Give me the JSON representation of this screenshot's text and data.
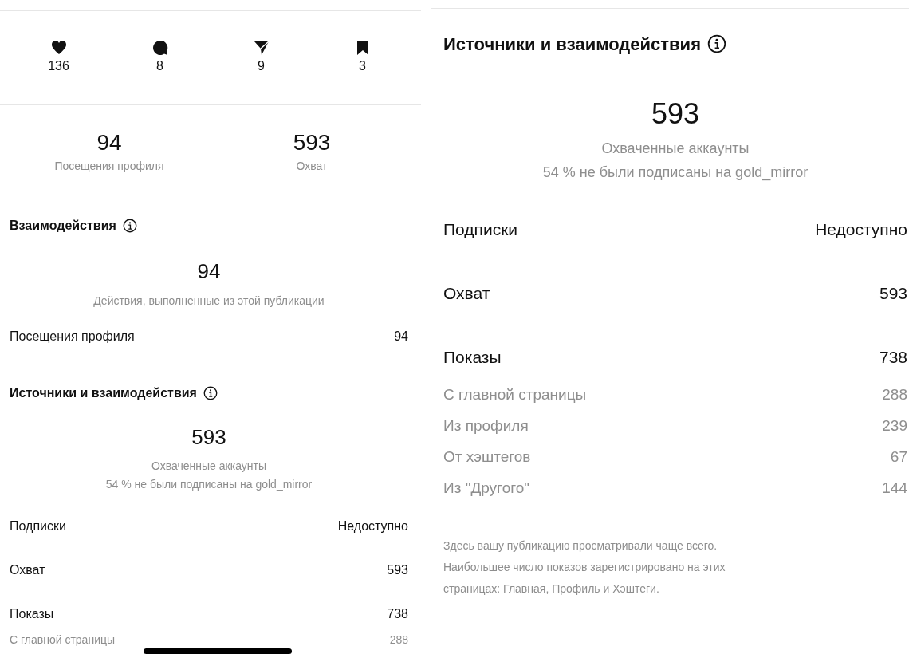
{
  "left": {
    "reactions": [
      {
        "kind": "like",
        "count": "136"
      },
      {
        "kind": "comment",
        "count": "8"
      },
      {
        "kind": "share",
        "count": "9"
      },
      {
        "kind": "save",
        "count": "3"
      }
    ],
    "summary": [
      {
        "value": "94",
        "label": "Посещения профиля"
      },
      {
        "value": "593",
        "label": "Охват"
      }
    ],
    "interactions": {
      "title": "Взаимодействия",
      "total": "94",
      "caption": "Действия, выполненные из этой публикации",
      "rows": [
        {
          "label": "Посещения профиля",
          "value": "94"
        }
      ]
    },
    "sources": {
      "title": "Источники и взаимодействия",
      "total": "593",
      "caption": "Охваченные аккаунты",
      "note": "54 % не были подписаны на gold_mirror",
      "rows": [
        {
          "kind": "main",
          "label": "Подписки",
          "value": "Недоступно"
        },
        {
          "kind": "main",
          "label": "Охват",
          "value": "593"
        },
        {
          "kind": "main",
          "label": "Показы",
          "value": "738"
        },
        {
          "kind": "sub",
          "label": "С главной страницы",
          "value": "288"
        }
      ]
    }
  },
  "right": {
    "sources": {
      "title": "Источники и взаимодействия",
      "total": "593",
      "caption": "Охваченные аккаунты",
      "note": "54 % не были подписаны на gold_mirror",
      "rows": [
        {
          "kind": "main",
          "label": "Подписки",
          "value": "Недоступно"
        },
        {
          "kind": "main",
          "label": "Охват",
          "value": "593"
        },
        {
          "kind": "main",
          "label": "Показы",
          "value": "738"
        },
        {
          "kind": "sub",
          "label": "С главной страницы",
          "value": "288"
        },
        {
          "kind": "sub",
          "label": "Из профиля",
          "value": "239"
        },
        {
          "kind": "sub",
          "label": "От хэштегов",
          "value": "67"
        },
        {
          "kind": "sub",
          "label": "Из \"Другого\"",
          "value": "144"
        }
      ]
    },
    "footnote": "Здесь вашу публикацию просматривали чаще всего. Наибольшее число показов зарегистрировано на этих страницах:  Главная, Профиль и Хэштеги."
  }
}
